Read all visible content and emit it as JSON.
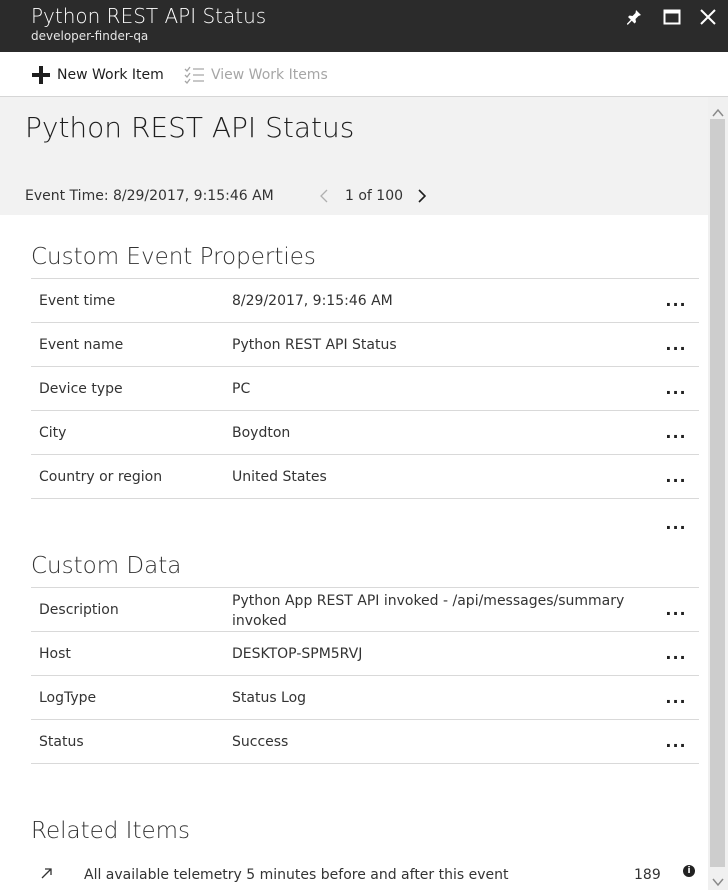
{
  "window": {
    "title": "Python REST API Status",
    "subtitle": "developer-finder-qa",
    "controls": [
      "pin-icon",
      "maximize-icon",
      "close-icon"
    ]
  },
  "toolbar": {
    "new_work_item": "New Work Item",
    "view_work_items": "View Work Items"
  },
  "header": {
    "title": "Python REST API Status",
    "event_time": "Event Time: 8/29/2017, 9:15:46 AM",
    "pager": "1 of 100"
  },
  "custom_event_properties": {
    "title": "Custom Event Properties",
    "rows": [
      {
        "name": "Event time",
        "value": "8/29/2017, 9:15:46 AM"
      },
      {
        "name": "Event name",
        "value": "Python REST API Status"
      },
      {
        "name": "Device type",
        "value": "PC"
      },
      {
        "name": "City",
        "value": "Boydton"
      },
      {
        "name": "Country or region",
        "value": "United States"
      }
    ]
  },
  "custom_data": {
    "title": "Custom Data",
    "rows": [
      {
        "name": "Description",
        "value": "Python App REST API invoked - /api/messages/summary invoked"
      },
      {
        "name": "Host",
        "value": "DESKTOP-SPM5RVJ"
      },
      {
        "name": "LogType",
        "value": "Status Log"
      },
      {
        "name": "Status",
        "value": "Success"
      }
    ]
  },
  "more_label": "...",
  "related_items": {
    "title": "Related Items",
    "items": [
      {
        "text": "All available telemetry 5 minutes before and after this event",
        "count": "189"
      }
    ]
  },
  "colors": {
    "titlebar": "#2b2b2b",
    "header_bg": "#f2f2f2",
    "divider": "#d9d9d9"
  }
}
